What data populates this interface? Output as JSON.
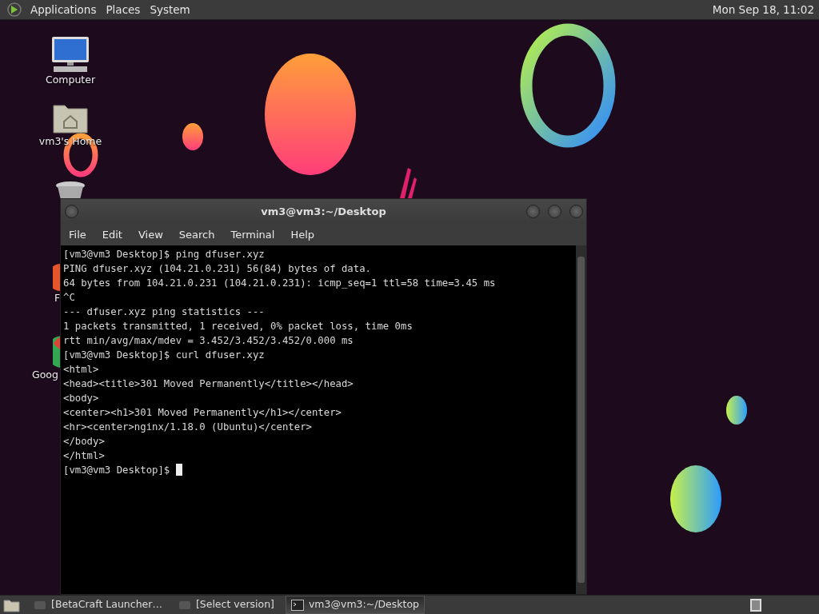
{
  "top_panel": {
    "menus": [
      "Applications",
      "Places",
      "System"
    ],
    "clock": "Mon Sep 18, 11:02"
  },
  "desktop_icons": [
    {
      "kind": "computer",
      "label": "Computer"
    },
    {
      "kind": "home",
      "label": "vm3's Home"
    },
    {
      "kind": "trash"
    },
    {
      "kind": "firefox",
      "label": "F"
    },
    {
      "kind": "chrome",
      "label": "Goog"
    }
  ],
  "terminal": {
    "title": "vm3@vm3:~/Desktop",
    "menu": [
      "File",
      "Edit",
      "View",
      "Search",
      "Terminal",
      "Help"
    ],
    "lines": [
      "[vm3@vm3 Desktop]$ ping dfuser.xyz",
      "PING dfuser.xyz (104.21.0.231) 56(84) bytes of data.",
      "64 bytes from 104.21.0.231 (104.21.0.231): icmp_seq=1 ttl=58 time=3.45 ms",
      "^C",
      "--- dfuser.xyz ping statistics ---",
      "1 packets transmitted, 1 received, 0% packet loss, time 0ms",
      "rtt min/avg/max/mdev = 3.452/3.452/3.452/0.000 ms",
      "[vm3@vm3 Desktop]$ curl dfuser.xyz",
      "<html>",
      "<head><title>301 Moved Permanently</title></head>",
      "<body>",
      "<center><h1>301 Moved Permanently</h1></center>",
      "<hr><center>nginx/1.18.0 (Ubuntu)</center>",
      "</body>",
      "</html>",
      "[vm3@vm3 Desktop]$ "
    ]
  },
  "taskbar": {
    "tasks": [
      {
        "kind": "app",
        "label": "[BetaCraft Launcher…",
        "selected": false
      },
      {
        "kind": "app",
        "label": "[Select version]",
        "selected": false
      },
      {
        "kind": "terminal",
        "label": "vm3@vm3:~/Desktop",
        "selected": true
      }
    ]
  }
}
